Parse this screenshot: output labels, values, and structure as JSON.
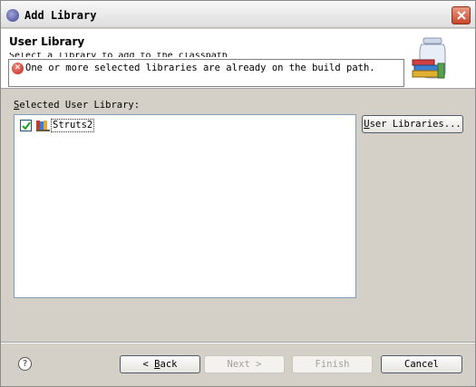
{
  "window": {
    "title": "Add Library",
    "icon": "eclipse-icon"
  },
  "header": {
    "title": "User Library",
    "description": "Select a library to add to the classpath",
    "message": "One or more selected libraries are already on the build path."
  },
  "body": {
    "selected_label_accel": "S",
    "selected_label_rest": "elected User Library:",
    "items": [
      {
        "label": "Struts2",
        "checked": true
      }
    ],
    "user_libraries_accel": "U",
    "user_libraries_rest": "ser Libraries..."
  },
  "footer": {
    "back_prefix": "< ",
    "back_accel": "B",
    "back_rest": "ack",
    "next_label": "Next >",
    "finish_label": "Finish",
    "cancel_label": "Cancel"
  }
}
